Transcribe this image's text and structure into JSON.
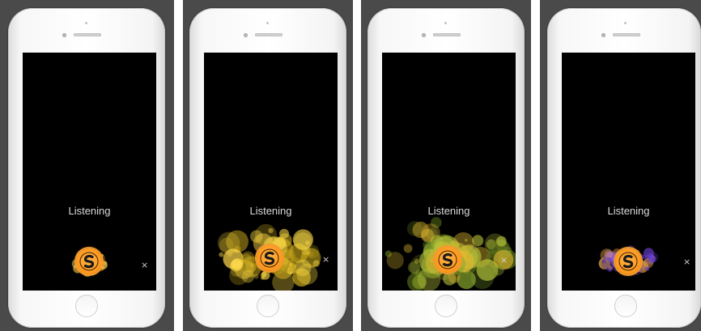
{
  "frames": [
    {
      "status": "Listening",
      "close": "×",
      "bokeh_palette": [
        "#ffb02e",
        "#ffcf4a",
        "#ff8a1a",
        "#ffe066"
      ]
    },
    {
      "status": "Listening",
      "close": "×",
      "bokeh_palette": [
        "#d4b21e",
        "#f0d040",
        "#b99a18",
        "#ffd84a"
      ]
    },
    {
      "status": "Listening",
      "close": "×",
      "bokeh_palette": [
        "#5f7a1c",
        "#8aa830",
        "#b7c23a",
        "#e0b830"
      ]
    },
    {
      "status": "Listening",
      "close": "×",
      "bokeh_palette": [
        "#6a3fd0",
        "#8c5cf0",
        "#ffb347",
        "#4a2fa8"
      ]
    }
  ],
  "icons": {
    "logo": "soundhound-logo-icon",
    "close": "close-icon",
    "home": "home-button-icon"
  },
  "colors": {
    "backdrop": "#4a4a4a",
    "screen": "#000000",
    "accent": "#ff9a1f"
  }
}
